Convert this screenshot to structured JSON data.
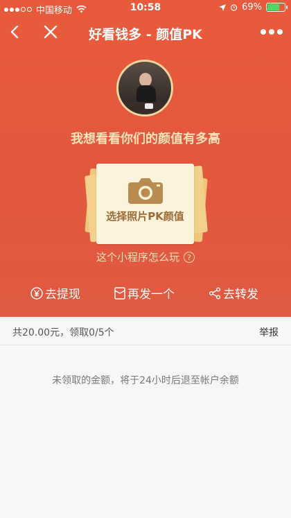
{
  "status_bar": {
    "carrier": "中国移动",
    "time": "10:58",
    "battery": "69%",
    "battery_level": 0.69
  },
  "nav": {
    "title": "好看钱多 - 颜值PK"
  },
  "headline": "我想看看你们的颜值有多高",
  "card": {
    "label": "选择照片PK颜值"
  },
  "howto": {
    "text": "这个小程序怎么玩",
    "icon": "?"
  },
  "actions": [
    {
      "label": "去提现",
      "icon": "yen-icon"
    },
    {
      "label": "再发一个",
      "icon": "redpacket-icon"
    },
    {
      "label": "去转发",
      "icon": "share-icon"
    }
  ],
  "summary": {
    "amount_text": "共20.00元，领取0/5个",
    "report_label": "举报"
  },
  "note": "未领取的金额，将于24小时后退至帐户余额",
  "colors": {
    "hero": "#e55a3e",
    "gold_text": "#f9e3b8",
    "card_bg": "#fcf3dc",
    "camera": "#b98b4e"
  }
}
